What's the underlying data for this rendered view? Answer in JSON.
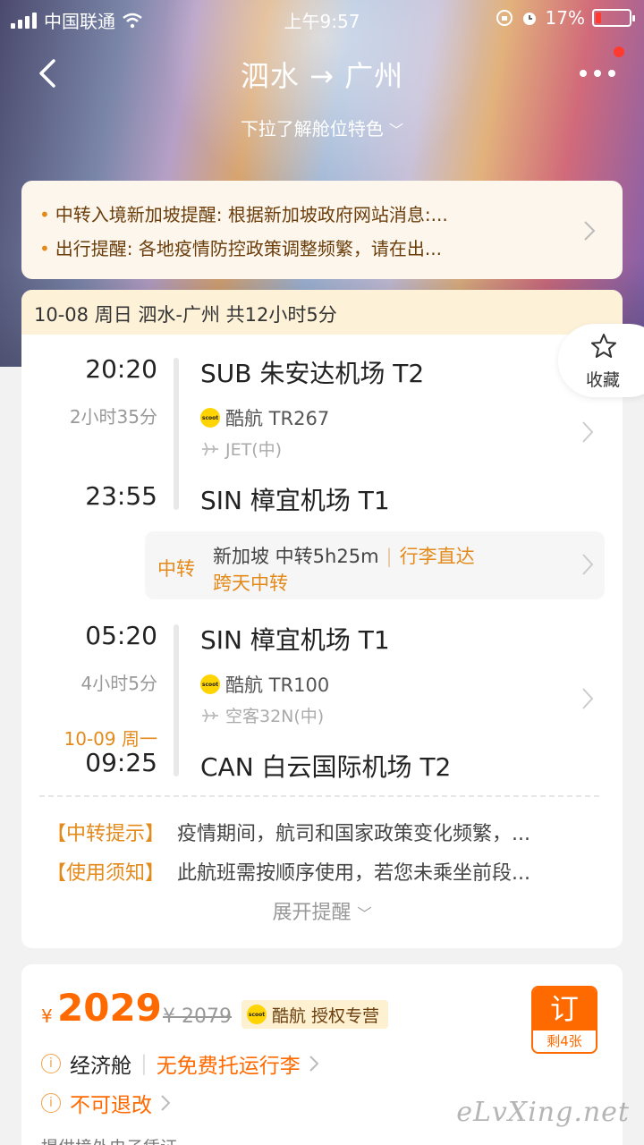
{
  "status": {
    "carrier": "中国联通",
    "time": "上午9:57",
    "battery": "17%",
    "battery_level": 0.17
  },
  "nav": {
    "title": "泗水 → 广州",
    "cabin_hint": "下拉了解舱位特色"
  },
  "notices": [
    "中转入境新加坡提醒: 根据新加坡政府网站消息:...",
    "出行提醒: 各地疫情防控政策调整频繁，请在出..."
  ],
  "trip": {
    "header": "10-08 周日 泗水-广州 共12小时5分",
    "segments": [
      {
        "dep_time": "20:20",
        "duration": "2小时35分",
        "arr_time": "23:55",
        "dep_airport": "SUB 朱安达机场 T2",
        "flight": "酷航 TR267",
        "plane": "JET(中)",
        "arr_airport": "SIN 樟宜机场 T1"
      },
      {
        "dep_time": "05:20",
        "duration": "4小时5分",
        "arr_date": "10-09 周一",
        "arr_time": "09:25",
        "dep_airport": "SIN 樟宜机场 T1",
        "flight": "酷航 TR100",
        "plane": "空客32N(中)",
        "arr_airport": "CAN 白云国际机场 T2"
      }
    ],
    "transfer": {
      "label": "中转",
      "city_time": "新加坡 中转5h25m",
      "baggage": "行李直达",
      "overnight": "跨天中转"
    },
    "tips": [
      {
        "tag": "【中转提示】",
        "text": "疫情期间，航司和国家政策变化频繁，..."
      },
      {
        "tag": "【使用须知】",
        "text": "此航班需按顺序使用，若您未乘坐前段..."
      }
    ],
    "expand": "展开提醒"
  },
  "favorite": {
    "label": "收藏"
  },
  "offer": {
    "currency": "¥",
    "price": "2029",
    "old_price": "¥ 2079",
    "agent": "酷航 授权专营",
    "book": "订",
    "remaining": "剩4张",
    "cabin": "经济舱",
    "baggage": "无免费托运行李",
    "refund": "不可退改",
    "note": "提供境外电子凭证"
  },
  "scoot_logo_text": "scoot",
  "watermark": "eLvXing.net"
}
